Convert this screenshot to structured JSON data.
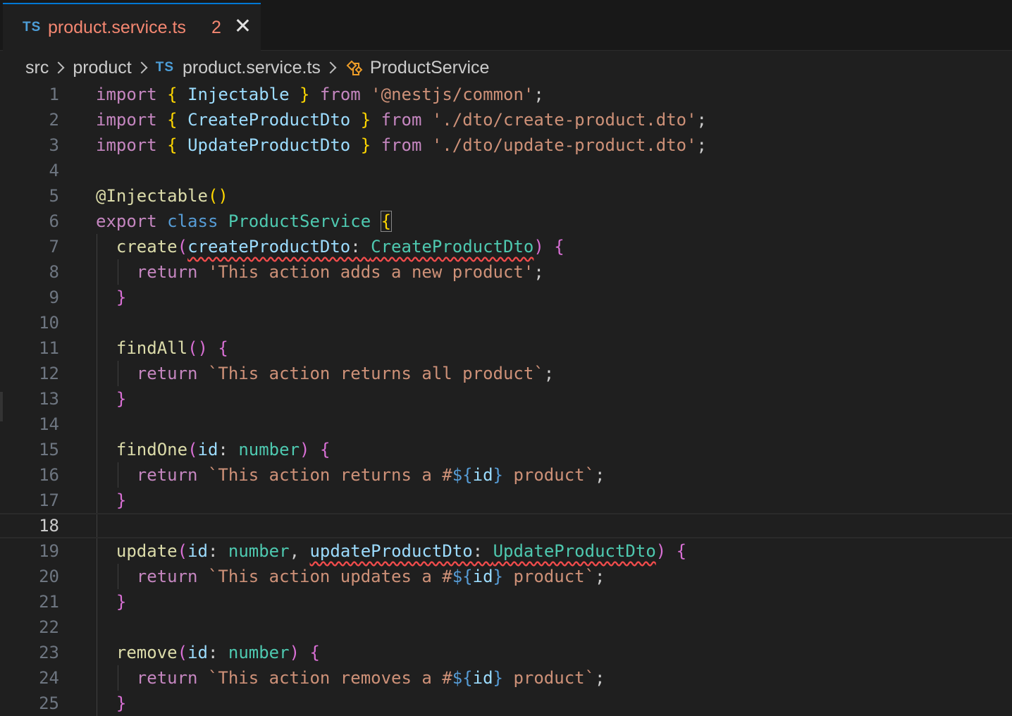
{
  "tab": {
    "lang_badge": "TS",
    "title": "product.service.ts",
    "problems": "2"
  },
  "breadcrumb": {
    "items": [
      "src",
      "product",
      "product.service.ts",
      "ProductService"
    ],
    "file_lang": "TS"
  },
  "editor": {
    "current_line": 18,
    "line_numbers": [
      "1",
      "2",
      "3",
      "4",
      "5",
      "6",
      "7",
      "8",
      "9",
      "10",
      "11",
      "12",
      "13",
      "14",
      "15",
      "16",
      "17",
      "18",
      "19",
      "20",
      "21",
      "22",
      "23",
      "24",
      "25"
    ],
    "tokens": {
      "import": "import",
      "from": "from",
      "export": "export",
      "class": "class",
      "return": "return",
      "injectable": "Injectable",
      "create_dto": "CreateProductDto",
      "update_dto": "UpdateProductDto",
      "mod_common": "'@nestjs/common'",
      "mod_create": "'./dto/create-product.dto'",
      "mod_update": "'./dto/update-product.dto'",
      "decorator": "@Injectable",
      "service": "ProductService",
      "create": "create",
      "create_param": "createProductDto",
      "str_create": "'This action adds a new product'",
      "findall": "findAll",
      "str_findall": "`This action returns all product`",
      "findone": "findOne",
      "id": "id",
      "number": "number",
      "tpl_returns_a": "`This action returns a #",
      "tpl_product": " product`",
      "update": "update",
      "update_param": "updateProductDto",
      "tpl_updates_a": "`This action updates a #",
      "remove": "remove",
      "tpl_removes_a": "`This action removes a #"
    }
  }
}
